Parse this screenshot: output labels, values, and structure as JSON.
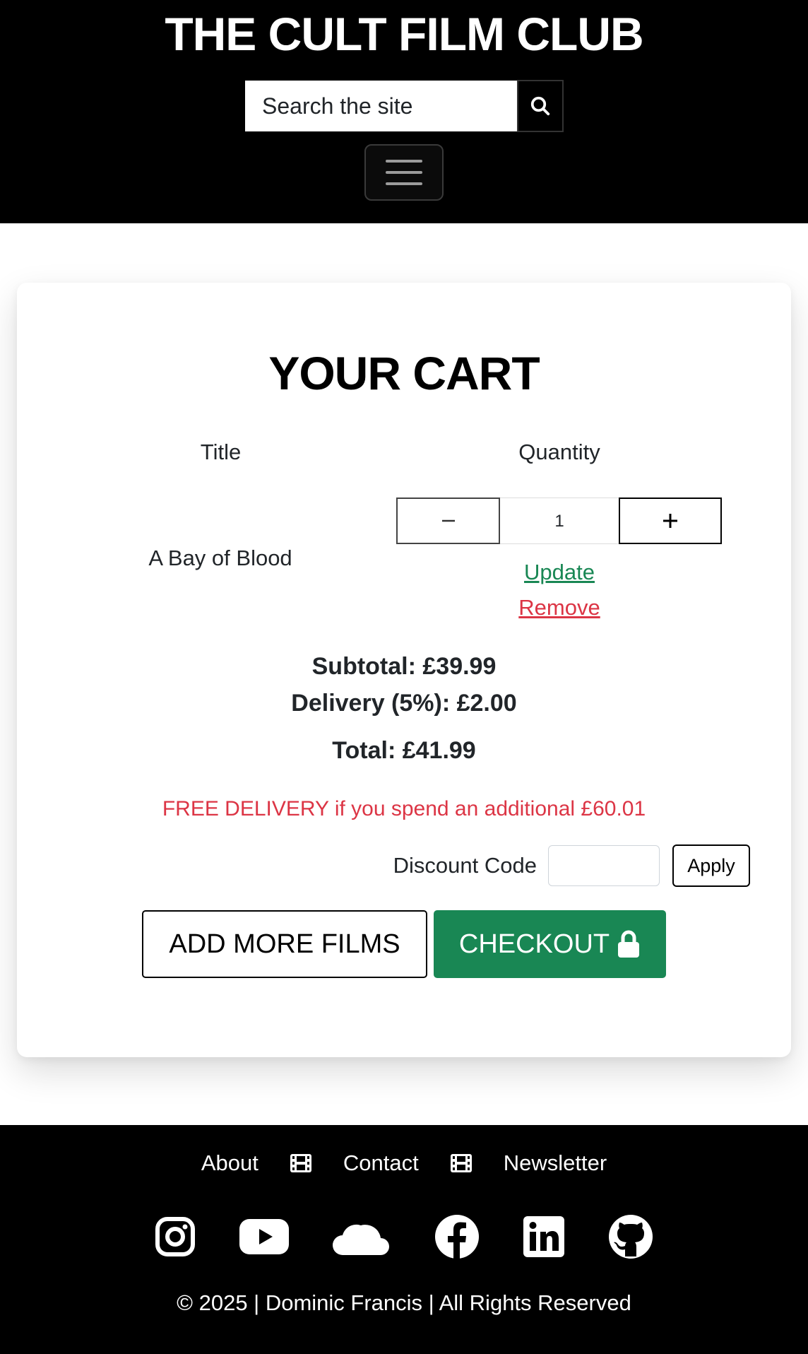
{
  "header": {
    "site_title": "THE CULT FILM CLUB",
    "search_placeholder": "Search the site",
    "search_icon": "search-icon",
    "menu_icon": "hamburger-icon"
  },
  "cart": {
    "heading": "YOUR CART",
    "columns": {
      "title": "Title",
      "quantity": "Quantity"
    },
    "items": [
      {
        "title": "A Bay of Blood",
        "quantity": "1",
        "update_label": "Update",
        "remove_label": "Remove"
      }
    ],
    "subtotal": "Subtotal: £39.99",
    "delivery": "Delivery (5%): £2.00",
    "total": "Total: £41.99",
    "free_delivery_message": "FREE DELIVERY if you spend an additional £60.01",
    "discount": {
      "label": "Discount Code",
      "value": "",
      "apply_label": "Apply"
    },
    "add_more_label": "ADD MORE FILMS",
    "checkout_label": "CHECKOUT",
    "checkout_icon": "lock-icon"
  },
  "footer": {
    "nav": [
      {
        "label": "About"
      },
      {
        "label": "Contact"
      },
      {
        "label": "Newsletter"
      }
    ],
    "separator_icon": "film-icon",
    "social_icons": [
      "instagram-icon",
      "youtube-icon",
      "soundcloud-icon",
      "facebook-icon",
      "linkedin-icon",
      "github-icon"
    ],
    "copyright": "© 2025 | Dominic Francis | All Rights Reserved"
  },
  "colors": {
    "header_bg": "#000000",
    "success": "#198754",
    "danger": "#dc3545"
  }
}
